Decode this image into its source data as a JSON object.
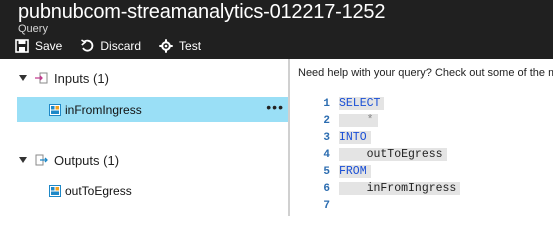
{
  "header": {
    "title": "pubnubcom-streamanalytics-012217-1252",
    "subtitle": "Query",
    "toolbar": [
      {
        "label": "Save",
        "icon": "save-icon"
      },
      {
        "label": "Discard",
        "icon": "discard-icon"
      },
      {
        "label": "Test",
        "icon": "gear-icon"
      }
    ]
  },
  "tree": {
    "inputs": {
      "label": "Inputs (1)",
      "items": [
        {
          "label": "inFromIngress",
          "selected": true
        }
      ]
    },
    "outputs": {
      "label": "Outputs (1)",
      "items": [
        {
          "label": "outToEgress",
          "selected": false
        }
      ]
    },
    "more_label": "•••"
  },
  "help_text": "Need help with your query? Check out some of the m",
  "editor": {
    "lines": [
      {
        "num": "1",
        "text": "SELECT"
      },
      {
        "num": "2",
        "text": "    *"
      },
      {
        "num": "3",
        "text": "INTO"
      },
      {
        "num": "4",
        "text": "    outToEgress"
      },
      {
        "num": "5",
        "text": "FROM"
      },
      {
        "num": "6",
        "text": "    inFromIngress"
      },
      {
        "num": "7",
        "text": ""
      }
    ]
  },
  "colors": {
    "header_bg": "#202020",
    "selection": "#9adff6",
    "keyword": "#1a4fd6",
    "line_number": "#2b6cb0"
  }
}
